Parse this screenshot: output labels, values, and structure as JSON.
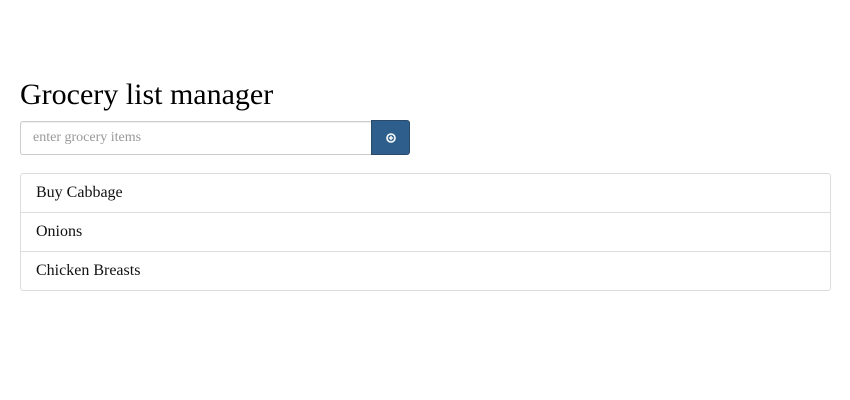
{
  "header": {
    "title": "Grocery list manager"
  },
  "input": {
    "placeholder": "enter grocery items",
    "value": ""
  },
  "add_button": {
    "icon": "add-circle-icon",
    "accent_color": "#2e5f8c"
  },
  "list": {
    "items": [
      {
        "label": "Buy Cabbage"
      },
      {
        "label": "Onions"
      },
      {
        "label": "Chicken Breasts"
      }
    ]
  }
}
